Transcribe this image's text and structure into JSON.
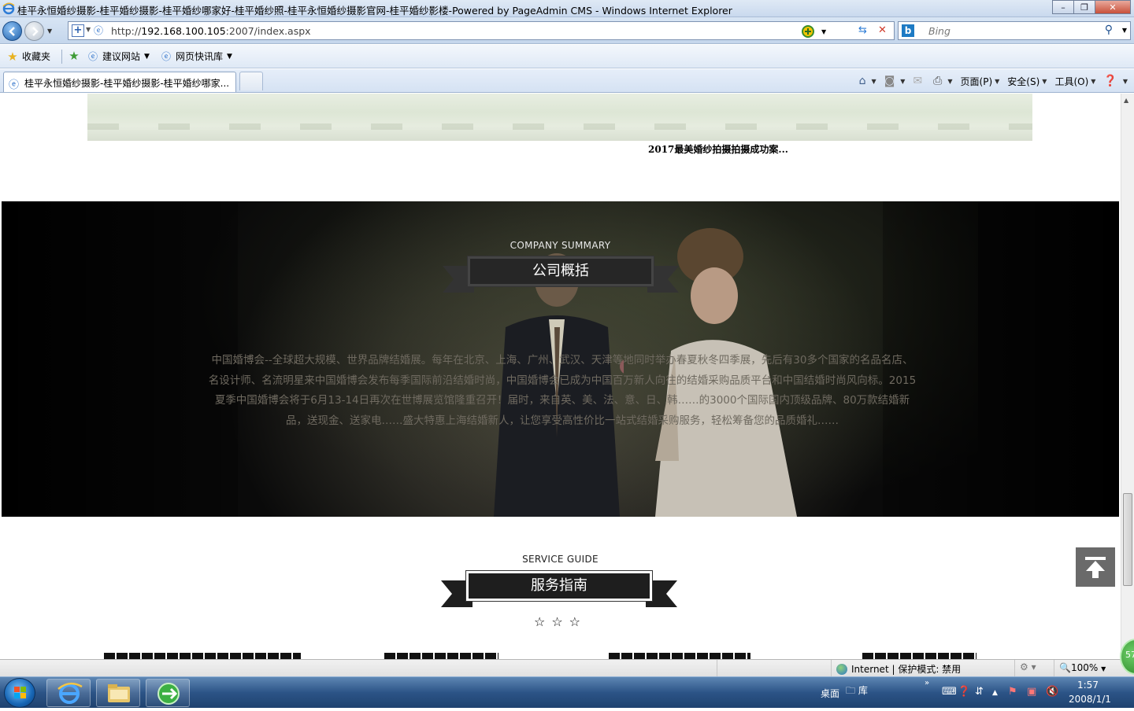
{
  "window": {
    "title": "桂平永恒婚纱摄影-桂平婚纱摄影-桂平婚纱哪家好-桂平婚纱照-桂平永恒婚纱摄影官网-桂平婚纱影楼-Powered by PageAdmin CMS - Windows Internet Explorer",
    "minimize": "–",
    "maximize": "❐",
    "close": "✕"
  },
  "address_bar": {
    "url_prefix": "http://",
    "url_host": "192.168.100.105",
    "url_rest": ":2007/index.aspx"
  },
  "search": {
    "placeholder": "Bing"
  },
  "favorites_bar": {
    "favorites": "收藏夹",
    "items": [
      {
        "label": "建议网站"
      },
      {
        "label": "网页快讯库"
      }
    ]
  },
  "tabs": [
    {
      "label": "桂平永恒婚纱摄影-桂平婚纱摄影-桂平婚纱哪家..."
    }
  ],
  "command_bar": {
    "page": "页面(P)",
    "safety": "安全(S)",
    "tools": "工具(O)"
  },
  "page": {
    "case_caption": "2017最美婚纱拍摄拍摄成功案...",
    "summary": {
      "en": "COMPANY SUMMARY",
      "zh": "公司概括",
      "text": "中国婚博会--全球超大规模、世界品牌结婚展。每年在北京、上海、广州、武汉、天津等地同时举办春夏秋冬四季展，先后有30多个国家的名品名店、名设计师、名流明星来中国婚博会发布每季国际前沿结婚时尚，中国婚博会已成为中国百万新人向往的结婚采购品质平台和中国结婚时尚风向标。2015夏季中国婚博会将于6月13-14日再次在世博展览馆隆重召开！届时，来自英、美、法、意、日、韩……的3000个国际国内顶级品牌、80万款结婚新品，送现金、送家电……盛大特惠上海结婚新人，让您享受高性价比一站式结婚采购服务，轻松筹备您的品质婚礼……"
    },
    "service": {
      "en": "SERVICE GUIDE",
      "zh": "服务指南",
      "stars": "☆☆☆"
    },
    "back_to_top": "⤒"
  },
  "statusbar": {
    "zone": "Internet | 保护模式: 禁用",
    "zoom": "100%"
  },
  "taskbar": {
    "desktop": "桌面",
    "library": "库",
    "time": "1:57",
    "date": "2008/1/1",
    "badge": "57"
  },
  "colors": {
    "ribbon": "#1e1e1e",
    "summary_text": "#6f6a60",
    "back_to_top": "#6a6a6a"
  }
}
